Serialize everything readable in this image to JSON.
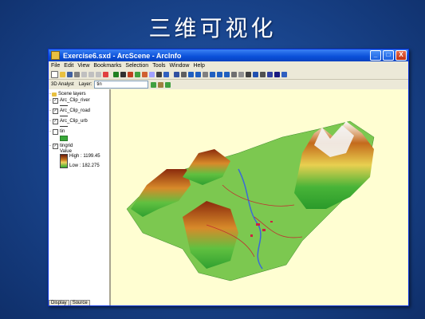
{
  "slide": {
    "title": "三维可视化"
  },
  "window": {
    "title": "Exercise6.sxd - ArcScene - ArcInfo",
    "controls": {
      "minimize": "_",
      "maximize": "□",
      "close": "X"
    }
  },
  "menu": [
    "File",
    "Edit",
    "View",
    "Bookmarks",
    "Selection",
    "Tools",
    "Window",
    "Help"
  ],
  "toolbar2": {
    "analyst_label": "3D Analyst",
    "layer_label": "Layer:",
    "layer_value": "tin"
  },
  "toc": {
    "root": "Scene layers",
    "layers": [
      "Arc_Clip_river",
      "Arc_Clip_road",
      "Arc_Clip_urb",
      "tin",
      "tingrid"
    ],
    "tingrid_value_label": "Value",
    "high": "High : 1199.45",
    "low": "Low : 182.275",
    "tabs": [
      "Display",
      "Source"
    ]
  },
  "colors": {
    "accent": "#0a4fd8",
    "scene_bg": "#fffed2",
    "slide_bg": "#1a468f"
  },
  "icons": [
    "app-icon",
    "new-icon",
    "open-icon",
    "save-icon",
    "print-icon",
    "navigate-icon",
    "zoom-icon",
    "pan-icon",
    "identify-icon",
    "fly-icon"
  ]
}
